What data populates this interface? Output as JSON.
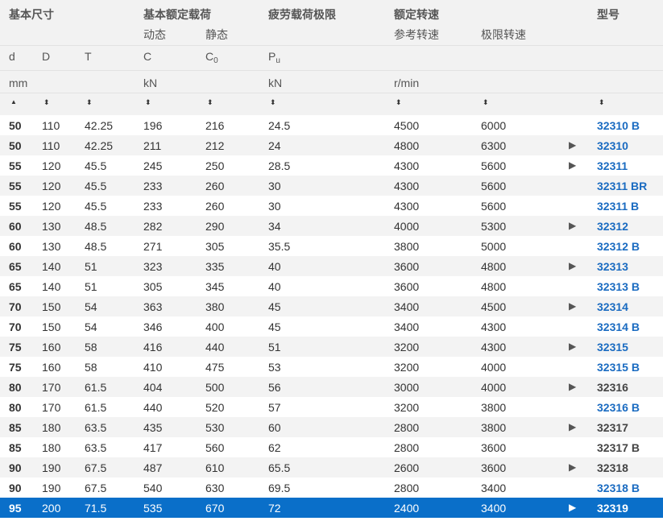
{
  "header": {
    "groups": {
      "basic_dims": "基本尺寸",
      "load_ratings": "基本额定载荷",
      "fatigue": "疲劳载荷极限",
      "speeds": "额定转速",
      "model": "型号"
    },
    "subs": {
      "dynamic": "动态",
      "static": "静态",
      "reference_speed": "参考转速",
      "limiting_speed": "极限转速"
    },
    "symbols": {
      "d": "d",
      "D": "D",
      "T": "T",
      "C": "C",
      "C0_base": "C",
      "C0_sub": "0",
      "Pu_base": "P",
      "Pu_sub": "u"
    },
    "units": {
      "mm": "mm",
      "kN_load": "kN",
      "kN_fatigue": "kN",
      "rpm": "r/min"
    },
    "sort": {
      "asc": "▲",
      "both": "⬍"
    }
  },
  "rows": [
    {
      "d": "50",
      "D": "110",
      "T": "42.25",
      "C": "196",
      "C0": "216",
      "Pu": "24.5",
      "ref": "4500",
      "lim": "6000",
      "arrow": "",
      "model": "32310 B",
      "link": true
    },
    {
      "d": "50",
      "D": "110",
      "T": "42.25",
      "C": "211",
      "C0": "212",
      "Pu": "24",
      "ref": "4800",
      "lim": "6300",
      "arrow": "▶",
      "model": "32310",
      "link": true
    },
    {
      "d": "55",
      "D": "120",
      "T": "45.5",
      "C": "245",
      "C0": "250",
      "Pu": "28.5",
      "ref": "4300",
      "lim": "5600",
      "arrow": "▶",
      "model": "32311",
      "link": true
    },
    {
      "d": "55",
      "D": "120",
      "T": "45.5",
      "C": "233",
      "C0": "260",
      "Pu": "30",
      "ref": "4300",
      "lim": "5600",
      "arrow": "",
      "model": "32311 BR",
      "link": true
    },
    {
      "d": "55",
      "D": "120",
      "T": "45.5",
      "C": "233",
      "C0": "260",
      "Pu": "30",
      "ref": "4300",
      "lim": "5600",
      "arrow": "",
      "model": "32311 B",
      "link": true
    },
    {
      "d": "60",
      "D": "130",
      "T": "48.5",
      "C": "282",
      "C0": "290",
      "Pu": "34",
      "ref": "4000",
      "lim": "5300",
      "arrow": "▶",
      "model": "32312",
      "link": true
    },
    {
      "d": "60",
      "D": "130",
      "T": "48.5",
      "C": "271",
      "C0": "305",
      "Pu": "35.5",
      "ref": "3800",
      "lim": "5000",
      "arrow": "",
      "model": "32312 B",
      "link": true
    },
    {
      "d": "65",
      "D": "140",
      "T": "51",
      "C": "323",
      "C0": "335",
      "Pu": "40",
      "ref": "3600",
      "lim": "4800",
      "arrow": "▶",
      "model": "32313",
      "link": true
    },
    {
      "d": "65",
      "D": "140",
      "T": "51",
      "C": "305",
      "C0": "345",
      "Pu": "40",
      "ref": "3600",
      "lim": "4800",
      "arrow": "",
      "model": "32313 B",
      "link": true
    },
    {
      "d": "70",
      "D": "150",
      "T": "54",
      "C": "363",
      "C0": "380",
      "Pu": "45",
      "ref": "3400",
      "lim": "4500",
      "arrow": "▶",
      "model": "32314",
      "link": true
    },
    {
      "d": "70",
      "D": "150",
      "T": "54",
      "C": "346",
      "C0": "400",
      "Pu": "45",
      "ref": "3400",
      "lim": "4300",
      "arrow": "",
      "model": "32314 B",
      "link": true
    },
    {
      "d": "75",
      "D": "160",
      "T": "58",
      "C": "416",
      "C0": "440",
      "Pu": "51",
      "ref": "3200",
      "lim": "4300",
      "arrow": "▶",
      "model": "32315",
      "link": true
    },
    {
      "d": "75",
      "D": "160",
      "T": "58",
      "C": "410",
      "C0": "475",
      "Pu": "53",
      "ref": "3200",
      "lim": "4000",
      "arrow": "",
      "model": "32315 B",
      "link": true
    },
    {
      "d": "80",
      "D": "170",
      "T": "61.5",
      "C": "404",
      "C0": "500",
      "Pu": "56",
      "ref": "3000",
      "lim": "4000",
      "arrow": "▶",
      "model": "32316",
      "link": false
    },
    {
      "d": "80",
      "D": "170",
      "T": "61.5",
      "C": "440",
      "C0": "520",
      "Pu": "57",
      "ref": "3200",
      "lim": "3800",
      "arrow": "",
      "model": "32316 B",
      "link": true
    },
    {
      "d": "85",
      "D": "180",
      "T": "63.5",
      "C": "435",
      "C0": "530",
      "Pu": "60",
      "ref": "2800",
      "lim": "3800",
      "arrow": "▶",
      "model": "32317",
      "link": false
    },
    {
      "d": "85",
      "D": "180",
      "T": "63.5",
      "C": "417",
      "C0": "560",
      "Pu": "62",
      "ref": "2800",
      "lim": "3600",
      "arrow": "",
      "model": "32317 B",
      "link": false
    },
    {
      "d": "90",
      "D": "190",
      "T": "67.5",
      "C": "487",
      "C0": "610",
      "Pu": "65.5",
      "ref": "2600",
      "lim": "3600",
      "arrow": "▶",
      "model": "32318",
      "link": false
    },
    {
      "d": "90",
      "D": "190",
      "T": "67.5",
      "C": "540",
      "C0": "630",
      "Pu": "69.5",
      "ref": "2800",
      "lim": "3400",
      "arrow": "",
      "model": "32318 B",
      "link": true
    },
    {
      "d": "95",
      "D": "200",
      "T": "71.5",
      "C": "535",
      "C0": "670",
      "Pu": "72",
      "ref": "2400",
      "lim": "3400",
      "arrow": "▶",
      "model": "32319",
      "link": true,
      "selected": true
    }
  ],
  "colors": {
    "header_bg": "#f2f2f2",
    "row_alt_bg": "#f3f3f3",
    "selected_bg": "#0a6fc9",
    "link": "#1a6bc1"
  }
}
